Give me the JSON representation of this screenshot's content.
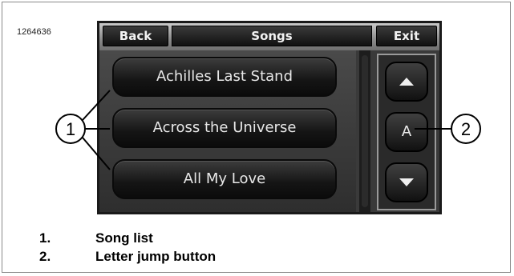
{
  "figure_id": "1264636",
  "topbar": {
    "back_label": "Back",
    "title": "Songs",
    "exit_label": "Exit"
  },
  "songs": [
    "Achilles Last Stand",
    "Across the Universe",
    "All My Love"
  ],
  "side": {
    "up_icon": "triangle-up-icon",
    "jump_letter": "A",
    "down_icon": "triangle-down-icon"
  },
  "callouts": [
    "1",
    "2"
  ],
  "legend": [
    {
      "num": "1.",
      "text": "Song list"
    },
    {
      "num": "2.",
      "text": "Letter jump button"
    }
  ]
}
